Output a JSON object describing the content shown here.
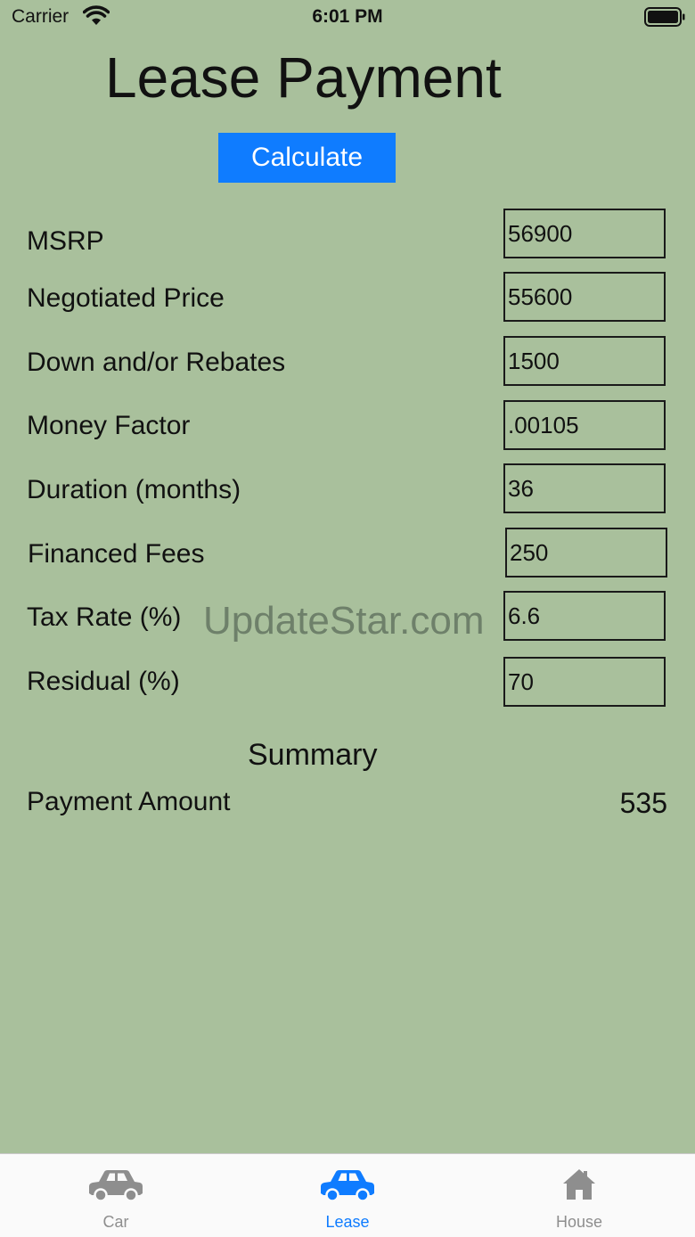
{
  "status_bar": {
    "carrier": "Carrier",
    "time": "6:01 PM"
  },
  "header": {
    "title": "Lease Payment",
    "calculate_label": "Calculate"
  },
  "form": {
    "fields": [
      {
        "label": "MSRP",
        "value": "56900"
      },
      {
        "label": "Negotiated Price",
        "value": "55600"
      },
      {
        "label": "Down and/or Rebates",
        "value": "1500"
      },
      {
        "label": "Money Factor",
        "value": ".00105"
      },
      {
        "label": "Duration (months)",
        "value": "36"
      },
      {
        "label": "Financed Fees",
        "value": "250"
      },
      {
        "label": "Tax Rate (%)",
        "value": "6.6"
      },
      {
        "label": "Residual (%)",
        "value": "70"
      }
    ]
  },
  "watermark": "UpdateStar.com",
  "summary": {
    "title": "Summary",
    "payment_label": "Payment Amount",
    "payment_value": "535"
  },
  "tab_bar": {
    "tabs": [
      {
        "label": "Car",
        "icon": "car-icon",
        "active": false
      },
      {
        "label": "Lease",
        "icon": "car-icon",
        "active": true
      },
      {
        "label": "House",
        "icon": "house-icon",
        "active": false
      }
    ]
  },
  "colors": {
    "background": "#a9c09c",
    "accent": "#0f7cff",
    "inactive_tab": "#8e8e8e"
  }
}
